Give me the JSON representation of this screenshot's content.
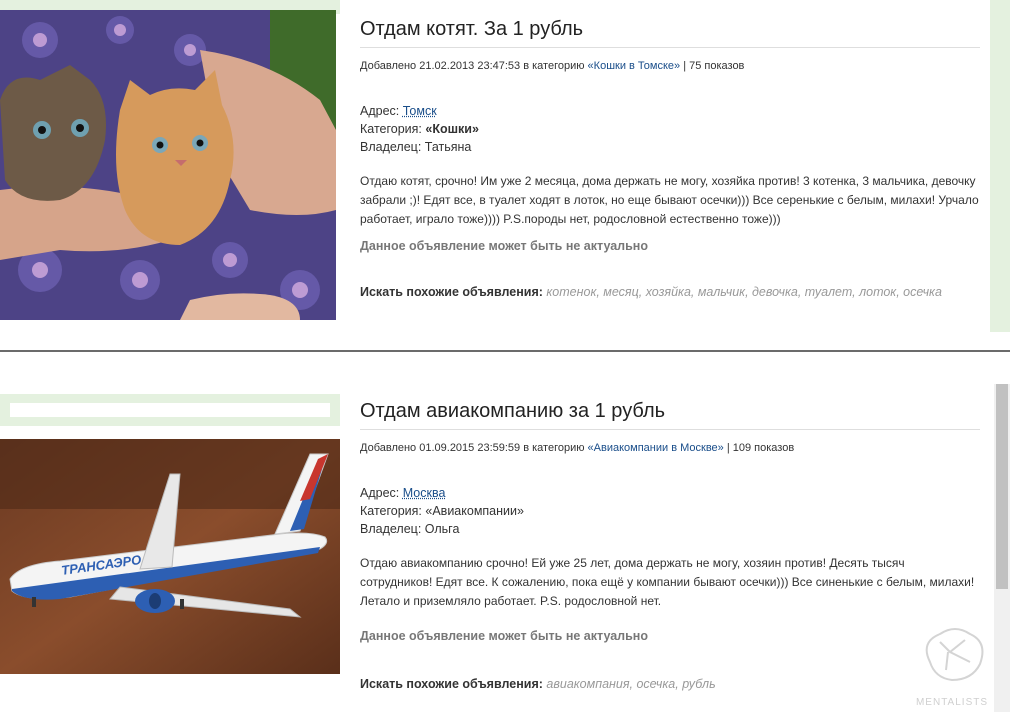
{
  "listings": [
    {
      "title": "Отдам котят. За 1 рубль",
      "meta_prefix": "Добавлено 21.02.2013 23:47:53 в категорию ",
      "meta_category": "«Кошки в Томске»",
      "meta_views": " | 75 показов",
      "address_label": "Адрес: ",
      "address_value": "Томск",
      "category_label": "Категория: ",
      "category_value": "«Кошки»",
      "owner_label": "Владелец: ",
      "owner_value": "Татьяна",
      "description": "Отдаю котят, срочно! Им уже 2 месяца, дома держать не могу, хозяйка против! 3 котенка, 3 мальчика, девочку забрали ;)! Едят все, в туалет ходят в лоток, но еще бывают осечки))) Все серенькие с белым, милахи! Урчало работает, играло тоже)))) P.S.породы нет, родословной естественно тоже)))",
      "notice": "Данное объявление может быть не актуально",
      "similar_label": "Искать похожие объявления:",
      "similar_tags": " котенок, месяц, хозяйка, мальчик, девочка, туалет, лоток, осечка",
      "photo": "kittens-photo"
    },
    {
      "title": "Отдам авиакомпанию за 1 рубль",
      "meta_prefix": "Добавлено 01.09.2015 23:59:59 в категорию ",
      "meta_category": "«Авиакомпании в Москве»",
      "meta_views": " | 109 показов",
      "address_label": "Адрес: ",
      "address_value": "Москва",
      "category_label": "Категория: ",
      "category_value": "«Авиакомпании»",
      "owner_label": "Владелец: ",
      "owner_value": "Ольга",
      "description": "Отдаю авиакомпанию срочно! Ей уже 25 лет, дома держать не могу, хозяин против! Десять тысяч сотрудников! Едят все. К сожалению, пока ещё у компании бывают осечки))) Все синенькие с белым, милахи! Летало и приземляло работает. P.S. родословной нет.",
      "notice": "Данное объявление может быть не актуально",
      "similar_label": "Искать похожие объявления:",
      "similar_tags": "  авиакомпания, осечка, рубль",
      "photo": "airplane-photo",
      "plane_livery": "ТРАНСАЭРО"
    }
  ],
  "watermark": "MENTALISTS",
  "colors": {
    "accent_green": "#e4f1df",
    "link": "#1a4e8a",
    "tag": "#999999"
  }
}
